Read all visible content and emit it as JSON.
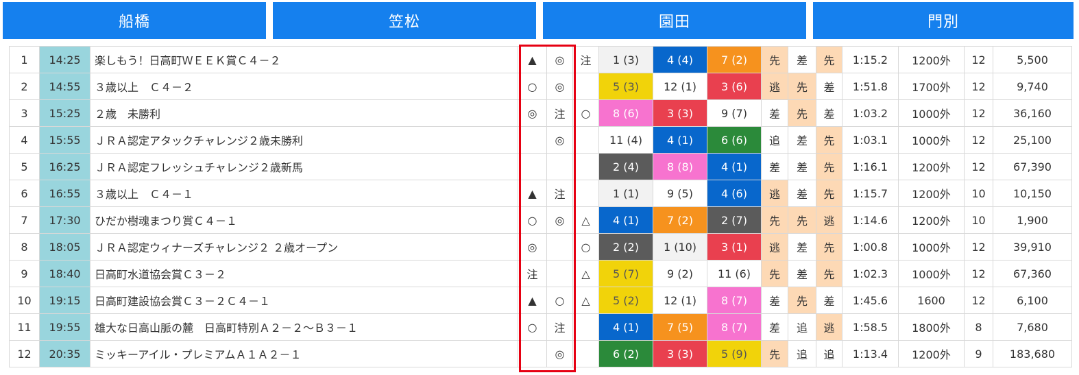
{
  "tabs": [
    "船橋",
    "笠松",
    "園田",
    "門別"
  ],
  "colors": {
    "tab_bg": "#1580ee",
    "time_bg": "#99d5dd",
    "pace_bg": "#fdd9b5",
    "highlight_border": "#e60012",
    "horse_numbers": {
      "1": {
        "bg": "#f2f2f2",
        "fg": "#333333"
      },
      "2": {
        "bg": "#5b5b5b",
        "fg": "#ffffff"
      },
      "3": {
        "bg": "#e9404f",
        "fg": "#ffffff"
      },
      "4": {
        "bg": "#0867cc",
        "fg": "#ffffff"
      },
      "5": {
        "bg": "#f1d30a",
        "fg": "#555555"
      },
      "6": {
        "bg": "#2b8a3a",
        "fg": "#ffffff"
      },
      "7": {
        "bg": "#f6921e",
        "fg": "#ffffff"
      },
      "8": {
        "bg": "#f773cf",
        "fg": "#ffffff"
      }
    }
  },
  "races": [
    {
      "no": "1",
      "time": "14:25",
      "title": "楽しもう！日高町ＷＥＥＫ賞Ｃ４－２",
      "m1": "▲",
      "m2": "◎",
      "m3": "注",
      "p1": "1 (3)",
      "p2": "4 (4)",
      "p3": "7 (2)",
      "s1": "先",
      "s2": "差",
      "s3": "先",
      "rt": "1:15.2",
      "dist": "1200外",
      "hc": "12",
      "pay": "5,500"
    },
    {
      "no": "2",
      "time": "14:55",
      "title": "３歳以上　Ｃ４－２",
      "m1": "○",
      "m2": "◎",
      "m3": "",
      "p1": "5 (3)",
      "p2": "12 (1)",
      "p3": "3 (6)",
      "s1": "逃",
      "s2": "先",
      "s3": "差",
      "rt": "1:51.8",
      "dist": "1700外",
      "hc": "12",
      "pay": "9,740"
    },
    {
      "no": "3",
      "time": "15:25",
      "title": "２歳　未勝利",
      "m1": "◎",
      "m2": "注",
      "m3": "○",
      "p1": "8 (6)",
      "p2": "3 (3)",
      "p3": "9 (7)",
      "s1": "差",
      "s2": "先",
      "s3": "差",
      "rt": "1:03.2",
      "dist": "1000外",
      "hc": "12",
      "pay": "36,160"
    },
    {
      "no": "4",
      "time": "15:55",
      "title": "ＪＲＡ認定アタックチャレンジ２歳未勝利",
      "m1": "",
      "m2": "◎",
      "m3": "",
      "p1": "11 (4)",
      "p2": "4 (1)",
      "p3": "6 (6)",
      "s1": "追",
      "s2": "差",
      "s3": "先",
      "rt": "1:03.1",
      "dist": "1000外",
      "hc": "12",
      "pay": "25,100"
    },
    {
      "no": "5",
      "time": "16:25",
      "title": "ＪＲＡ認定フレッシュチャレンジ２歳新馬",
      "m1": "",
      "m2": "",
      "m3": "",
      "p1": "2 (4)",
      "p2": "8 (8)",
      "p3": "4 (1)",
      "s1": "差",
      "s2": "差",
      "s3": "先",
      "rt": "1:16.1",
      "dist": "1200外",
      "hc": "12",
      "pay": "67,390"
    },
    {
      "no": "6",
      "time": "16:55",
      "title": "３歳以上　Ｃ４－１",
      "m1": "▲",
      "m2": "注",
      "m3": "",
      "p1": "1 (1)",
      "p2": "9 (5)",
      "p3": "4 (6)",
      "s1": "逃",
      "s2": "差",
      "s3": "先",
      "rt": "1:15.7",
      "dist": "1200外",
      "hc": "10",
      "pay": "10,150"
    },
    {
      "no": "7",
      "time": "17:30",
      "title": "ひだか樹魂まつり賞Ｃ４－１",
      "m1": "○",
      "m2": "◎",
      "m3": "△",
      "p1": "4 (1)",
      "p2": "7 (2)",
      "p3": "2 (7)",
      "s1": "先",
      "s2": "先",
      "s3": "逃",
      "rt": "1:14.6",
      "dist": "1200外",
      "hc": "10",
      "pay": "1,900"
    },
    {
      "no": "8",
      "time": "18:05",
      "title": "ＪＲＡ認定ウィナーズチャレンジ２ ２歳オープン",
      "m1": "◎",
      "m2": "",
      "m3": "○",
      "p1": "2 (2)",
      "p2": "1 (10)",
      "p3": "3 (1)",
      "s1": "逃",
      "s2": "差",
      "s3": "先",
      "rt": "1:00.8",
      "dist": "1000外",
      "hc": "12",
      "pay": "39,910"
    },
    {
      "no": "9",
      "time": "18:40",
      "title": "日高町水道協会賞Ｃ３－２",
      "m1": "注",
      "m2": "",
      "m3": "△",
      "p1": "5 (7)",
      "p2": "9 (2)",
      "p3": "11 (6)",
      "s1": "先",
      "s2": "差",
      "s3": "先",
      "rt": "1:02.3",
      "dist": "1000外",
      "hc": "12",
      "pay": "67,360"
    },
    {
      "no": "10",
      "time": "19:15",
      "title": "日高町建設協会賞Ｃ３－２Ｃ４－１",
      "m1": "▲",
      "m2": "○",
      "m3": "△",
      "p1": "5 (2)",
      "p2": "12 (1)",
      "p3": "8 (7)",
      "s1": "差",
      "s2": "先",
      "s3": "差",
      "rt": "1:45.6",
      "dist": "1600",
      "hc": "12",
      "pay": "6,100"
    },
    {
      "no": "11",
      "time": "19:55",
      "title": "雄大な日高山脈の麓　日高町特別Ａ２－２～Ｂ３－１",
      "m1": "○",
      "m2": "注",
      "m3": "",
      "p1": "4 (1)",
      "p2": "7 (5)",
      "p3": "8 (7)",
      "s1": "差",
      "s2": "追",
      "s3": "逃",
      "rt": "1:58.5",
      "dist": "1800外",
      "hc": "8",
      "pay": "7,680"
    },
    {
      "no": "12",
      "time": "20:35",
      "title": "ミッキーアイル・プレミアムＡ１Ａ２－１",
      "m1": "",
      "m2": "◎",
      "m3": "",
      "p1": "6 (2)",
      "p2": "3 (3)",
      "p3": "5 (9)",
      "s1": "先",
      "s2": "追",
      "s3": "追",
      "rt": "1:13.4",
      "dist": "1200外",
      "hc": "9",
      "pay": "183,680"
    }
  ]
}
